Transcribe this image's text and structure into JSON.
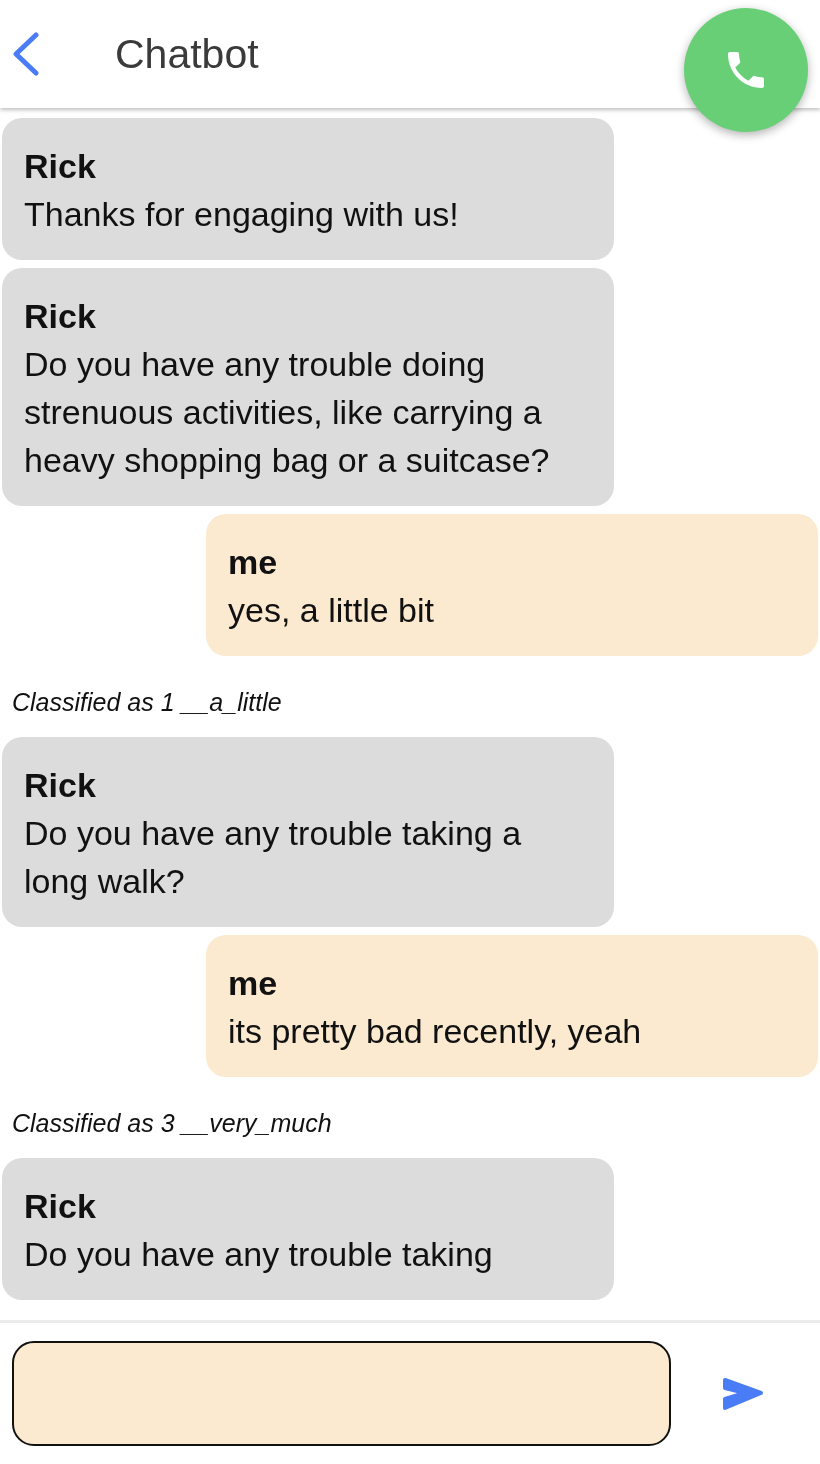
{
  "header": {
    "title": "Chatbot"
  },
  "messages": [
    {
      "kind": "bot",
      "sender": "Rick",
      "text": "Thanks for engaging with us!"
    },
    {
      "kind": "bot",
      "sender": "Rick",
      "text": "Do you have any trouble doing strenuous activities, like carrying a heavy shopping bag or a suitcase?"
    },
    {
      "kind": "user",
      "sender": "me",
      "text": "yes, a little bit"
    },
    {
      "kind": "note",
      "text": "Classified as 1 __a_little"
    },
    {
      "kind": "bot",
      "sender": "Rick",
      "text": "Do you have any trouble taking a long walk?"
    },
    {
      "kind": "user",
      "sender": "me",
      "text": "its pretty bad recently, yeah"
    },
    {
      "kind": "note",
      "text": "Classified as 3 __very_much"
    },
    {
      "kind": "bot",
      "sender": "Rick",
      "text": "Do you have any trouble taking"
    }
  ]
}
